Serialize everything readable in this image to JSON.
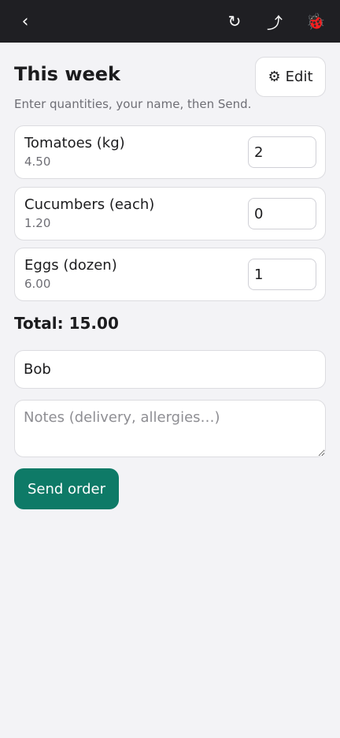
{
  "topbar": {
    "back_icon": "chevron-left-icon",
    "back_glyph": "‹",
    "reload_icon": "reload-icon",
    "reload_glyph": "↻",
    "share_icon": "share-arrow-icon",
    "share_glyph": "⤴",
    "bug_icon": "ladybug-icon",
    "bug_glyph": "🐞",
    "background": "#1f1f23"
  },
  "header": {
    "title": "This week",
    "edit_icon_glyph": "⚙",
    "edit_label": "Edit",
    "subtitle": "Enter quantities, your name, then Send."
  },
  "items": [
    {
      "name": "Tomatoes (kg)",
      "price": "4.50",
      "quantity": "2"
    },
    {
      "name": "Cucumbers (each)",
      "price": "1.20",
      "quantity": "0"
    },
    {
      "name": "Eggs (dozen)",
      "price": "6.00",
      "quantity": "1"
    }
  ],
  "total": {
    "text": "Total: 15.00"
  },
  "form": {
    "name_value": "Bob",
    "notes_placeholder": "Notes (delivery, allergies…)",
    "send_label": "Send order"
  },
  "colors": {
    "accent": "#0e7a67",
    "page_bg": "#f3f3f6"
  }
}
